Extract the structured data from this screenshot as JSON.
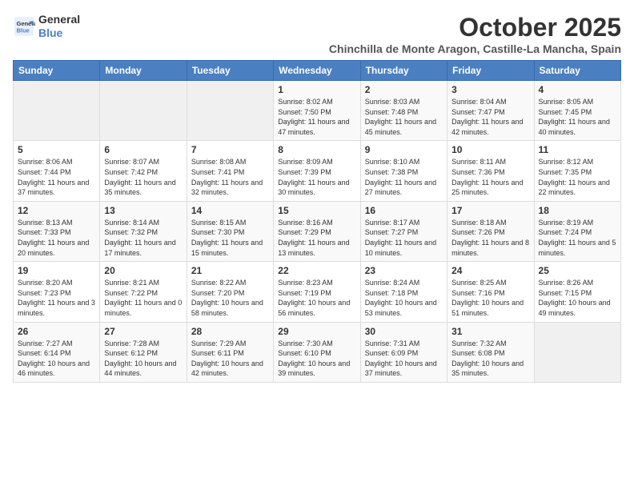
{
  "logo": {
    "line1": "General",
    "line2": "Blue"
  },
  "title": "October 2025",
  "location": "Chinchilla de Monte Aragon, Castille-La Mancha, Spain",
  "weekdays": [
    "Sunday",
    "Monday",
    "Tuesday",
    "Wednesday",
    "Thursday",
    "Friday",
    "Saturday"
  ],
  "weeks": [
    [
      {
        "day": "",
        "info": ""
      },
      {
        "day": "",
        "info": ""
      },
      {
        "day": "",
        "info": ""
      },
      {
        "day": "1",
        "info": "Sunrise: 8:02 AM\nSunset: 7:50 PM\nDaylight: 11 hours and 47 minutes."
      },
      {
        "day": "2",
        "info": "Sunrise: 8:03 AM\nSunset: 7:48 PM\nDaylight: 11 hours and 45 minutes."
      },
      {
        "day": "3",
        "info": "Sunrise: 8:04 AM\nSunset: 7:47 PM\nDaylight: 11 hours and 42 minutes."
      },
      {
        "day": "4",
        "info": "Sunrise: 8:05 AM\nSunset: 7:45 PM\nDaylight: 11 hours and 40 minutes."
      }
    ],
    [
      {
        "day": "5",
        "info": "Sunrise: 8:06 AM\nSunset: 7:44 PM\nDaylight: 11 hours and 37 minutes."
      },
      {
        "day": "6",
        "info": "Sunrise: 8:07 AM\nSunset: 7:42 PM\nDaylight: 11 hours and 35 minutes."
      },
      {
        "day": "7",
        "info": "Sunrise: 8:08 AM\nSunset: 7:41 PM\nDaylight: 11 hours and 32 minutes."
      },
      {
        "day": "8",
        "info": "Sunrise: 8:09 AM\nSunset: 7:39 PM\nDaylight: 11 hours and 30 minutes."
      },
      {
        "day": "9",
        "info": "Sunrise: 8:10 AM\nSunset: 7:38 PM\nDaylight: 11 hours and 27 minutes."
      },
      {
        "day": "10",
        "info": "Sunrise: 8:11 AM\nSunset: 7:36 PM\nDaylight: 11 hours and 25 minutes."
      },
      {
        "day": "11",
        "info": "Sunrise: 8:12 AM\nSunset: 7:35 PM\nDaylight: 11 hours and 22 minutes."
      }
    ],
    [
      {
        "day": "12",
        "info": "Sunrise: 8:13 AM\nSunset: 7:33 PM\nDaylight: 11 hours and 20 minutes."
      },
      {
        "day": "13",
        "info": "Sunrise: 8:14 AM\nSunset: 7:32 PM\nDaylight: 11 hours and 17 minutes."
      },
      {
        "day": "14",
        "info": "Sunrise: 8:15 AM\nSunset: 7:30 PM\nDaylight: 11 hours and 15 minutes."
      },
      {
        "day": "15",
        "info": "Sunrise: 8:16 AM\nSunset: 7:29 PM\nDaylight: 11 hours and 13 minutes."
      },
      {
        "day": "16",
        "info": "Sunrise: 8:17 AM\nSunset: 7:27 PM\nDaylight: 11 hours and 10 minutes."
      },
      {
        "day": "17",
        "info": "Sunrise: 8:18 AM\nSunset: 7:26 PM\nDaylight: 11 hours and 8 minutes."
      },
      {
        "day": "18",
        "info": "Sunrise: 8:19 AM\nSunset: 7:24 PM\nDaylight: 11 hours and 5 minutes."
      }
    ],
    [
      {
        "day": "19",
        "info": "Sunrise: 8:20 AM\nSunset: 7:23 PM\nDaylight: 11 hours and 3 minutes."
      },
      {
        "day": "20",
        "info": "Sunrise: 8:21 AM\nSunset: 7:22 PM\nDaylight: 11 hours and 0 minutes."
      },
      {
        "day": "21",
        "info": "Sunrise: 8:22 AM\nSunset: 7:20 PM\nDaylight: 10 hours and 58 minutes."
      },
      {
        "day": "22",
        "info": "Sunrise: 8:23 AM\nSunset: 7:19 PM\nDaylight: 10 hours and 56 minutes."
      },
      {
        "day": "23",
        "info": "Sunrise: 8:24 AM\nSunset: 7:18 PM\nDaylight: 10 hours and 53 minutes."
      },
      {
        "day": "24",
        "info": "Sunrise: 8:25 AM\nSunset: 7:16 PM\nDaylight: 10 hours and 51 minutes."
      },
      {
        "day": "25",
        "info": "Sunrise: 8:26 AM\nSunset: 7:15 PM\nDaylight: 10 hours and 49 minutes."
      }
    ],
    [
      {
        "day": "26",
        "info": "Sunrise: 7:27 AM\nSunset: 6:14 PM\nDaylight: 10 hours and 46 minutes."
      },
      {
        "day": "27",
        "info": "Sunrise: 7:28 AM\nSunset: 6:12 PM\nDaylight: 10 hours and 44 minutes."
      },
      {
        "day": "28",
        "info": "Sunrise: 7:29 AM\nSunset: 6:11 PM\nDaylight: 10 hours and 42 minutes."
      },
      {
        "day": "29",
        "info": "Sunrise: 7:30 AM\nSunset: 6:10 PM\nDaylight: 10 hours and 39 minutes."
      },
      {
        "day": "30",
        "info": "Sunrise: 7:31 AM\nSunset: 6:09 PM\nDaylight: 10 hours and 37 minutes."
      },
      {
        "day": "31",
        "info": "Sunrise: 7:32 AM\nSunset: 6:08 PM\nDaylight: 10 hours and 35 minutes."
      },
      {
        "day": "",
        "info": ""
      }
    ]
  ]
}
